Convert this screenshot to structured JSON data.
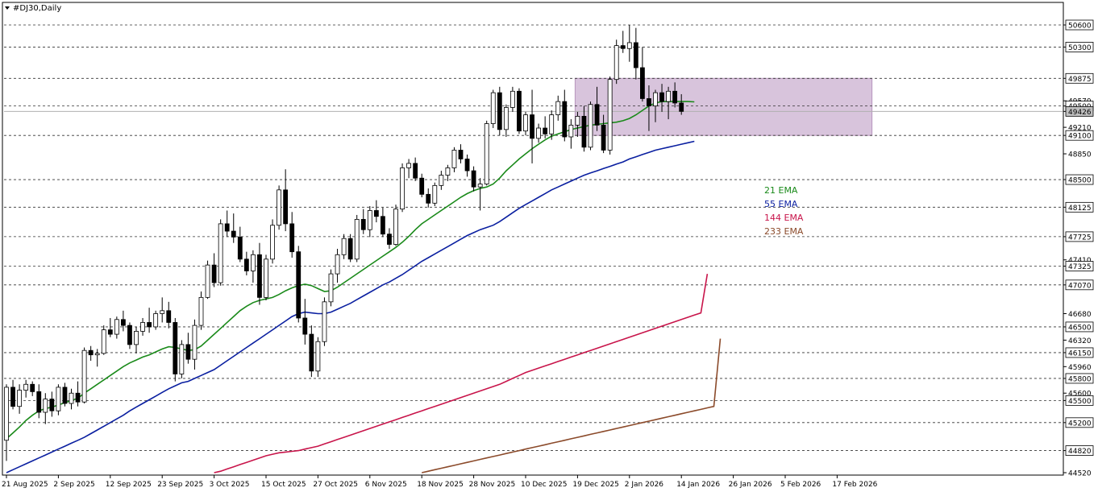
{
  "window": {
    "title": "#DJ30,Daily"
  },
  "chart_data": {
    "type": "candlestick",
    "symbol": "#DJ30",
    "timeframe": "Daily",
    "ylim": [
      44520,
      50600
    ],
    "y_tick_labels": [
      50600,
      50300,
      49875,
      49570,
      49500,
      49426,
      49210,
      49100,
      48850,
      48500,
      48125,
      47725,
      47410,
      47325,
      47070,
      46680,
      46500,
      46320,
      46150,
      45960,
      45800,
      45600,
      45500,
      45200,
      44820,
      44520
    ],
    "y_highlight_ticks": [
      50600,
      50300,
      49875,
      49500,
      49100,
      48500,
      48125,
      47725,
      47325,
      47070,
      46500,
      46150,
      45800,
      45500,
      45200,
      44820
    ],
    "dashed_levels": [
      50600,
      50300,
      49875,
      49500,
      49100,
      48500,
      48125,
      47725,
      47325,
      47070,
      46500,
      46150,
      45800,
      45500,
      45200,
      44820
    ],
    "current_price": 49426,
    "x_tick_labels": [
      "21 Aug 2025",
      "2 Sep 2025",
      "12 Sep 2025",
      "23 Sep 2025",
      "3 Oct 2025",
      "15 Oct 2025",
      "27 Oct 2025",
      "6 Nov 2025",
      "18 Nov 2025",
      "28 Nov 2025",
      "10 Dec 2025",
      "19 Dec 2025",
      "2 Jan 2026",
      "14 Jan 2026",
      "26 Jan 2026",
      "5 Feb 2026",
      "17 Feb 2026"
    ],
    "x_tick_bar_index": [
      0,
      8,
      16,
      24,
      32,
      40,
      48,
      56,
      64,
      72,
      80,
      88,
      96,
      104,
      112,
      120,
      128
    ],
    "range_box": {
      "from_bar": 88,
      "to_bar": 133,
      "low": 49100,
      "high": 49875
    },
    "grid": false,
    "candles": [
      [
        44960,
        45720,
        44680,
        45680
      ],
      [
        45680,
        45780,
        45380,
        45420
      ],
      [
        45420,
        45720,
        45320,
        45640
      ],
      [
        45640,
        45780,
        45540,
        45720
      ],
      [
        45720,
        45760,
        45560,
        45620
      ],
      [
        45620,
        45720,
        45260,
        45340
      ],
      [
        45340,
        45600,
        45180,
        45520
      ],
      [
        45520,
        45620,
        45280,
        45360
      ],
      [
        45360,
        45720,
        45300,
        45680
      ],
      [
        45680,
        45740,
        45420,
        45460
      ],
      [
        45460,
        45660,
        45380,
        45600
      ],
      [
        45600,
        45760,
        45420,
        45480
      ],
      [
        45480,
        46220,
        45460,
        46180
      ],
      [
        46180,
        46240,
        46040,
        46120
      ],
      [
        46120,
        46200,
        45960,
        46140
      ],
      [
        46140,
        46520,
        46120,
        46460
      ],
      [
        46460,
        46620,
        46360,
        46400
      ],
      [
        46400,
        46640,
        46340,
        46600
      ],
      [
        46600,
        46720,
        46440,
        46520
      ],
      [
        46520,
        46560,
        46200,
        46260
      ],
      [
        46260,
        46500,
        46140,
        46440
      ],
      [
        46440,
        46620,
        46380,
        46560
      ],
      [
        46560,
        46760,
        46420,
        46500
      ],
      [
        46500,
        46720,
        46460,
        46680
      ],
      [
        46680,
        46900,
        46560,
        46720
      ],
      [
        46720,
        46840,
        46480,
        46560
      ],
      [
        46560,
        46620,
        45760,
        45860
      ],
      [
        45860,
        46320,
        45800,
        46260
      ],
      [
        46260,
        46420,
        46000,
        46060
      ],
      [
        46060,
        46600,
        45920,
        46520
      ],
      [
        46520,
        46980,
        46460,
        46900
      ],
      [
        46900,
        47400,
        46880,
        47340
      ],
      [
        47340,
        47500,
        47040,
        47100
      ],
      [
        47100,
        47960,
        47060,
        47900
      ],
      [
        47900,
        48080,
        47720,
        47800
      ],
      [
        47800,
        48040,
        47640,
        47720
      ],
      [
        47720,
        47860,
        47380,
        47420
      ],
      [
        47420,
        47520,
        47200,
        47260
      ],
      [
        47260,
        47540,
        47100,
        47480
      ],
      [
        47480,
        47640,
        46800,
        46900
      ],
      [
        46900,
        47480,
        46860,
        47420
      ],
      [
        47420,
        47960,
        47360,
        47880
      ],
      [
        47880,
        48420,
        47820,
        48360
      ],
      [
        48360,
        48640,
        47800,
        47900
      ],
      [
        47900,
        48060,
        47440,
        47520
      ],
      [
        47520,
        47600,
        46560,
        46620
      ],
      [
        46620,
        46880,
        46260,
        46400
      ],
      [
        46400,
        46520,
        45820,
        45900
      ],
      [
        45900,
        46360,
        45820,
        46300
      ],
      [
        46300,
        46900,
        46240,
        46840
      ],
      [
        46840,
        47280,
        46780,
        47220
      ],
      [
        47220,
        47560,
        47100,
        47480
      ],
      [
        47480,
        47760,
        47420,
        47700
      ],
      [
        47700,
        47760,
        47380,
        47420
      ],
      [
        47420,
        48020,
        47380,
        47960
      ],
      [
        47960,
        48100,
        47760,
        47820
      ],
      [
        47820,
        48140,
        47720,
        48080
      ],
      [
        48080,
        48220,
        47920,
        48000
      ],
      [
        48000,
        48120,
        47720,
        47760
      ],
      [
        47760,
        47840,
        47560,
        47620
      ],
      [
        47620,
        48160,
        47600,
        48100
      ],
      [
        48100,
        48720,
        48060,
        48660
      ],
      [
        48660,
        48780,
        48520,
        48720
      ],
      [
        48720,
        48800,
        48480,
        48520
      ],
      [
        48520,
        48580,
        48260,
        48300
      ],
      [
        48300,
        48380,
        48120,
        48180
      ],
      [
        48180,
        48460,
        48140,
        48420
      ],
      [
        48420,
        48620,
        48360,
        48560
      ],
      [
        48560,
        48700,
        48480,
        48660
      ],
      [
        48660,
        48940,
        48600,
        48900
      ],
      [
        48900,
        48980,
        48720,
        48780
      ],
      [
        48780,
        48840,
        48540,
        48620
      ],
      [
        48620,
        48680,
        48340,
        48400
      ],
      [
        48400,
        48520,
        48080,
        48440
      ],
      [
        48440,
        49300,
        48420,
        49260
      ],
      [
        49260,
        49720,
        49200,
        49680
      ],
      [
        49680,
        49760,
        49100,
        49180
      ],
      [
        49180,
        49520,
        49080,
        49480
      ],
      [
        49480,
        49760,
        49420,
        49700
      ],
      [
        49700,
        49740,
        49120,
        49160
      ],
      [
        49160,
        49420,
        49100,
        49380
      ],
      [
        49380,
        49720,
        48720,
        49060
      ],
      [
        49060,
        49260,
        49000,
        49200
      ],
      [
        49200,
        49360,
        49060,
        49120
      ],
      [
        49120,
        49440,
        49040,
        49380
      ],
      [
        49380,
        49640,
        49300,
        49560
      ],
      [
        49560,
        49720,
        49020,
        49080
      ],
      [
        49080,
        49320,
        48920,
        49240
      ],
      [
        49240,
        49420,
        49080,
        49360
      ],
      [
        49360,
        49500,
        48880,
        48940
      ],
      [
        48940,
        49560,
        48900,
        49520
      ],
      [
        49520,
        49760,
        49160,
        49240
      ],
      [
        49240,
        49380,
        48860,
        48900
      ],
      [
        48900,
        49900,
        48840,
        49860
      ],
      [
        49860,
        50400,
        49800,
        50320
      ],
      [
        50320,
        50520,
        50220,
        50280
      ],
      [
        50280,
        50600,
        50100,
        50360
      ],
      [
        50360,
        50560,
        49860,
        50020
      ],
      [
        50020,
        50300,
        49560,
        49600
      ],
      [
        49600,
        49780,
        49160,
        49500
      ],
      [
        49500,
        49720,
        49280,
        49680
      ],
      [
        49680,
        49800,
        49420,
        49560
      ],
      [
        49560,
        49760,
        49320,
        49700
      ],
      [
        49700,
        49820,
        49480,
        49540
      ],
      [
        49540,
        49660,
        49380,
        49426
      ]
    ],
    "series": [
      {
        "name": "21 EMA",
        "color": "#1a8a1a",
        "first_bar": 0,
        "values": [
          44980,
          45060,
          45140,
          45230,
          45300,
          45360,
          45390,
          45410,
          45440,
          45470,
          45500,
          45530,
          45600,
          45660,
          45720,
          45780,
          45840,
          45900,
          45960,
          46010,
          46050,
          46090,
          46120,
          46160,
          46200,
          46230,
          46220,
          46200,
          46180,
          46190,
          46240,
          46320,
          46400,
          46480,
          46560,
          46640,
          46720,
          46780,
          46830,
          46860,
          46880,
          46900,
          46940,
          46990,
          47030,
          47060,
          47080,
          47060,
          47020,
          46980,
          46990,
          47040,
          47100,
          47160,
          47220,
          47280,
          47340,
          47400,
          47460,
          47520,
          47580,
          47650,
          47730,
          47820,
          47900,
          47960,
          48020,
          48080,
          48140,
          48200,
          48260,
          48310,
          48350,
          48380,
          48400,
          48440,
          48520,
          48620,
          48700,
          48780,
          48850,
          48920,
          48980,
          49040,
          49090,
          49120,
          49150,
          49180,
          49200,
          49220,
          49240,
          49250,
          49260,
          49270,
          49280,
          49300,
          49330,
          49380,
          49440,
          49500,
          49540,
          49560,
          49560,
          49560,
          49560,
          49560,
          49556
        ]
      },
      {
        "name": "55 EMA",
        "color": "#0a1fa0",
        "first_bar": 0,
        "values": [
          44520,
          44560,
          44600,
          44640,
          44680,
          44720,
          44760,
          44800,
          44840,
          44880,
          44920,
          44960,
          45000,
          45050,
          45100,
          45150,
          45200,
          45250,
          45300,
          45360,
          45410,
          45460,
          45510,
          45560,
          45610,
          45660,
          45700,
          45740,
          45760,
          45800,
          45840,
          45880,
          45920,
          45980,
          46040,
          46100,
          46160,
          46220,
          46280,
          46340,
          46400,
          46460,
          46520,
          46580,
          46640,
          46680,
          46700,
          46690,
          46680,
          46680,
          46700,
          46740,
          46780,
          46820,
          46870,
          46920,
          46970,
          47020,
          47070,
          47110,
          47160,
          47210,
          47270,
          47330,
          47390,
          47440,
          47490,
          47540,
          47590,
          47640,
          47690,
          47740,
          47780,
          47820,
          47850,
          47880,
          47930,
          47990,
          48050,
          48110,
          48160,
          48210,
          48260,
          48310,
          48360,
          48400,
          48440,
          48480,
          48520,
          48560,
          48590,
          48620,
          48650,
          48680,
          48710,
          48740,
          48780,
          48810,
          48840,
          48870,
          48900,
          48920,
          48940,
          48960,
          48980,
          49000,
          49020
        ]
      },
      {
        "name": "144 EMA",
        "color": "#c8144a",
        "first_bar": 32,
        "values": [
          44520,
          44540,
          44570,
          44600,
          44630,
          44660,
          44690,
          44720,
          44750,
          44770,
          44790,
          44800,
          44810,
          44820,
          44840,
          44860,
          44880,
          44910,
          44940,
          44970,
          45000,
          45030,
          45060,
          45090,
          45120,
          45150,
          45180,
          45210,
          45240,
          45270,
          45300,
          45330,
          45360,
          45390,
          45420,
          45450,
          45480,
          45510,
          45540,
          45570,
          45600,
          45630,
          45660,
          45690,
          45720,
          45760,
          45800,
          45840,
          45880,
          45910,
          45940,
          45970,
          46000,
          46030,
          46060,
          46090,
          46120,
          46150,
          46180,
          46210,
          46240,
          46270,
          46300,
          46330,
          46360,
          46390,
          46420,
          46450,
          46480,
          46510,
          46540,
          46570,
          46600,
          46630,
          46660,
          46690,
          47220
        ]
      },
      {
        "name": "233 EMA",
        "color": "#8b4a2a",
        "first_bar": 64,
        "values": [
          44520,
          44540,
          44560,
          44580,
          44600,
          44620,
          44640,
          44660,
          44680,
          44700,
          44720,
          44740,
          44760,
          44780,
          44800,
          44820,
          44840,
          44860,
          44880,
          44900,
          44920,
          44940,
          44960,
          44980,
          45000,
          45020,
          45040,
          45060,
          45080,
          45100,
          45120,
          45140,
          45160,
          45180,
          45200,
          45220,
          45240,
          45260,
          45280,
          45300,
          45320,
          45340,
          45360,
          45380,
          45400,
          45420,
          46340
        ]
      }
    ]
  }
}
